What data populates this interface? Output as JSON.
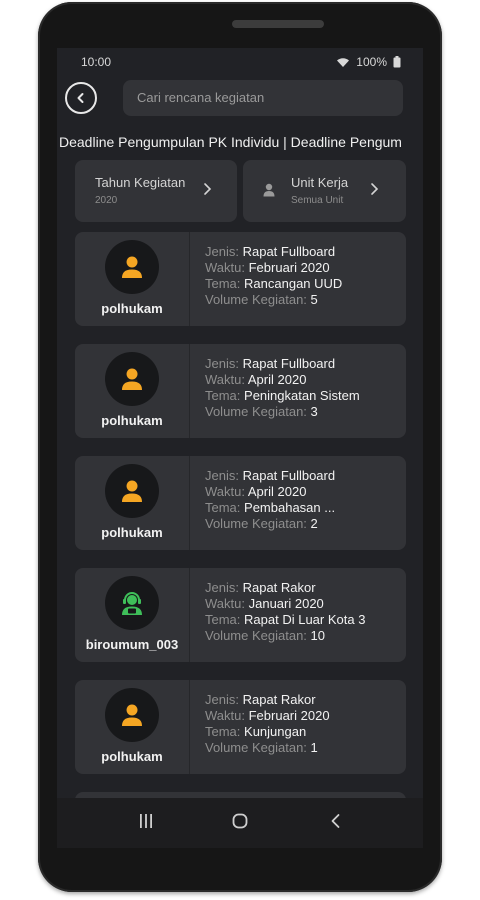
{
  "status": {
    "time": "10:00",
    "battery": "100%"
  },
  "search": {
    "placeholder": "Cari rencana kegiatan"
  },
  "marquee": "Deadline Pengumpulan PK Individu | Deadline Pengum",
  "filters": [
    {
      "title": "Tahun Kegiatan",
      "value": "2020"
    },
    {
      "title": "Unit Kerja",
      "value": "Semua Unit"
    }
  ],
  "labels": {
    "jenis": "Jenis:",
    "waktu": "Waktu:",
    "tema": "Tema:",
    "volume": "Volume Kegiatan:"
  },
  "cards": [
    {
      "user": "polhukam",
      "jenis": "Rapat Fullboard",
      "waktu": "Februari 2020",
      "tema": "Rancangan UUD",
      "volume": "5"
    },
    {
      "user": "polhukam",
      "jenis": "Rapat Fullboard",
      "waktu": "April 2020",
      "tema": "Peningkatan Sistem",
      "volume": "3"
    },
    {
      "user": "polhukam",
      "jenis": "Rapat Fullboard",
      "waktu": "April 2020",
      "tema": "Pembahasan ...",
      "volume": "2"
    },
    {
      "user": "biroumum_003",
      "jenis": "Rapat Rakor",
      "waktu": "Januari 2020",
      "tema": "Rapat Di Luar Kota 3",
      "volume": "10"
    },
    {
      "user": "polhukam",
      "jenis": "Rapat Rakor",
      "waktu": "Februari 2020",
      "tema": "Kunjungan",
      "volume": "1"
    }
  ],
  "colors": {
    "avatar_orange": "#f5a623",
    "avatar_green": "#3fbf5a"
  },
  "icons": {
    "back": "back-arrow-icon",
    "chevron": "chevron-right-icon",
    "unit": "person-icon"
  }
}
